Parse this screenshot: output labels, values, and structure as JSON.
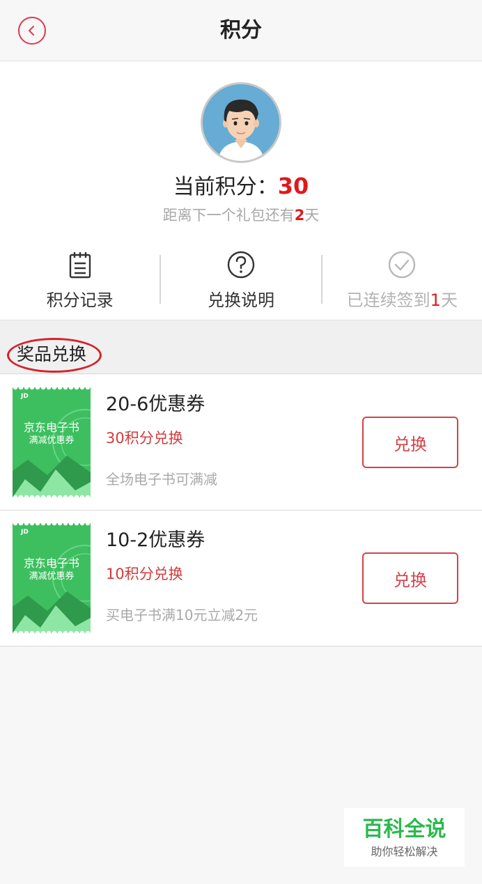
{
  "header": {
    "title": "积分"
  },
  "profile": {
    "points_label": "当前积分：",
    "points_value": "30",
    "hint_prefix": "距离下一个礼包还有",
    "hint_days": "2",
    "hint_suffix": "天"
  },
  "actions": {
    "record_label": "积分记录",
    "rules_label": "兑换说明",
    "checkin_prefix": "已连续签到",
    "checkin_days": "1",
    "checkin_suffix": "天"
  },
  "section": {
    "title": "奖品兑换"
  },
  "rewards": [
    {
      "name": "20-6优惠券",
      "cost": "30积分兑换",
      "desc": "全场电子书可满减",
      "button": "兑换",
      "coupon_title": "京东电子书",
      "coupon_subtitle": "满减优惠券"
    },
    {
      "name": "10-2优惠券",
      "cost": "10积分兑换",
      "desc": "买电子书满10元立减2元",
      "button": "兑换",
      "coupon_title": "京东电子书",
      "coupon_subtitle": "满减优惠券"
    }
  ],
  "coupon_brand": "JD",
  "watermark": {
    "title": "百科全说",
    "subtitle": "助你轻松解决"
  },
  "colors": {
    "accent_red": "#e0191b",
    "coupon_green": "#3dbf5f",
    "watermark_green": "#2db84f"
  }
}
